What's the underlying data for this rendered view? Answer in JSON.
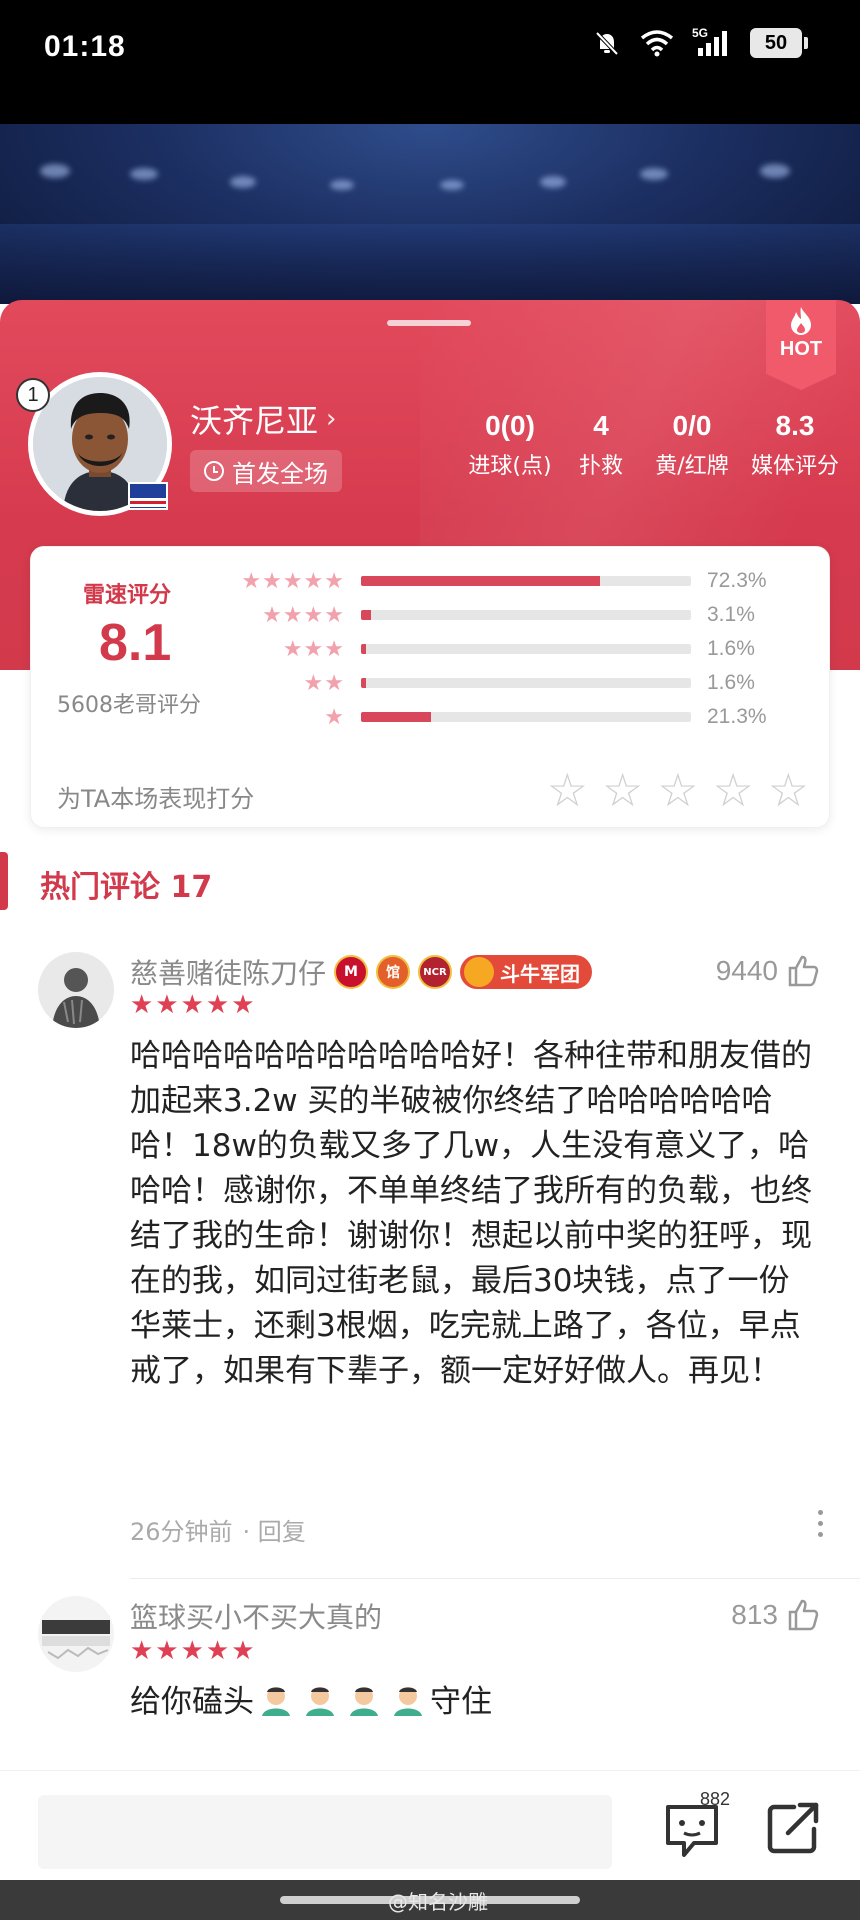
{
  "status_bar": {
    "time": "01:18",
    "network": "5G",
    "battery": "50"
  },
  "hot_badge": "HOT",
  "player": {
    "jersey_number": "1",
    "name": "沃齐尼亚",
    "start_status": "首发全场"
  },
  "stats": [
    {
      "value": "0(0)",
      "label": "进球(点)"
    },
    {
      "value": "4",
      "label": "扑救"
    },
    {
      "value": "0/0",
      "label": "黄/红牌"
    },
    {
      "value": "8.3",
      "label": "媒体评分"
    }
  ],
  "rating": {
    "title": "雷速评分",
    "score": "8.1",
    "count_text": "5608老哥评分",
    "distribution": [
      {
        "stars": "★★★★★",
        "percent_text": "72.3%",
        "fraction": 0.723
      },
      {
        "stars": "★★★★",
        "percent_text": "3.1%",
        "fraction": 0.031
      },
      {
        "stars": "★★★",
        "percent_text": "1.6%",
        "fraction": 0.016
      },
      {
        "stars": "★★",
        "percent_text": "1.6%",
        "fraction": 0.016
      },
      {
        "stars": "★",
        "percent_text": "21.3%",
        "fraction": 0.213
      }
    ],
    "prompt": "为TA本场表现打分"
  },
  "comments_section": {
    "title": "热门评论 17"
  },
  "comments": [
    {
      "username": "慈善赌徒陈刀仔",
      "team_badge": "斗牛军团",
      "stars": "★★★★★",
      "likes": "9440",
      "text": "哈哈哈哈哈哈哈哈哈哈哈好！各种往带和朋友借的加起来3.2w 买的半破被你终结了哈哈哈哈哈哈哈！18w的负载又多了几w，人生没有意义了，哈哈哈！感谢你，不单单终结了我所有的负载，也终结了我的生命！谢谢你！想起以前中奖的狂呼，现在的我，如同过街老鼠，最后30块钱，点了一份华莱士，还剩3根烟，吃完就上路了，各位，早点戒了，如果有下辈子，额一定好好做人。再见！",
      "time": "26分钟前",
      "reply_label": "· 回复"
    },
    {
      "username": "篮球买小不买大真的",
      "stars": "★★★★★",
      "likes": "813",
      "text_before": "给你磕头",
      "text_after": "守住"
    }
  ],
  "bottom_bar": {
    "comment_count": "882"
  },
  "watermark": "@知名沙雕",
  "colors": {
    "accent": "#d23a4c",
    "panel": "#e24a5c",
    "star_pink": "#f2a2ac"
  }
}
